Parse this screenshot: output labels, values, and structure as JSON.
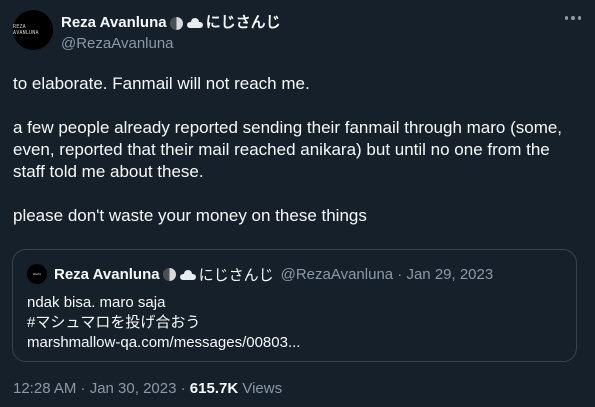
{
  "author": {
    "avatar_text": "REZA AVANLUNA",
    "display_name": "Reza Avanluna",
    "affiliation": "にじさんじ",
    "handle": "@RezaAvanluna"
  },
  "tweet": {
    "text": "to elaborate. Fanmail will not reach me.\n\na few people already reported sending their fanmail through maro (some, even, reported that their mail reached anikara) but until no one from the staff told me about these.\n\nplease don't waste your money on these things"
  },
  "quoted": {
    "avatar_text": "REZA",
    "display_name": "Reza Avanluna",
    "affiliation": "にじさんじ",
    "meta": "@RezaAvanluna · Jan 29, 2023",
    "text": "ndak bisa. maro saja\n#マシュマロを投げ合おう\nmarshmallow-qa.com/messages/00803..."
  },
  "footer": {
    "timestamp": "12:28 AM · Jan 30, 2023 ·",
    "views_count": "615.7K",
    "views_label": "Views"
  },
  "icons": {
    "moon": "moon-emoji-icon",
    "cloud": "cloud-emoji-icon",
    "more": "more-options-icon"
  }
}
